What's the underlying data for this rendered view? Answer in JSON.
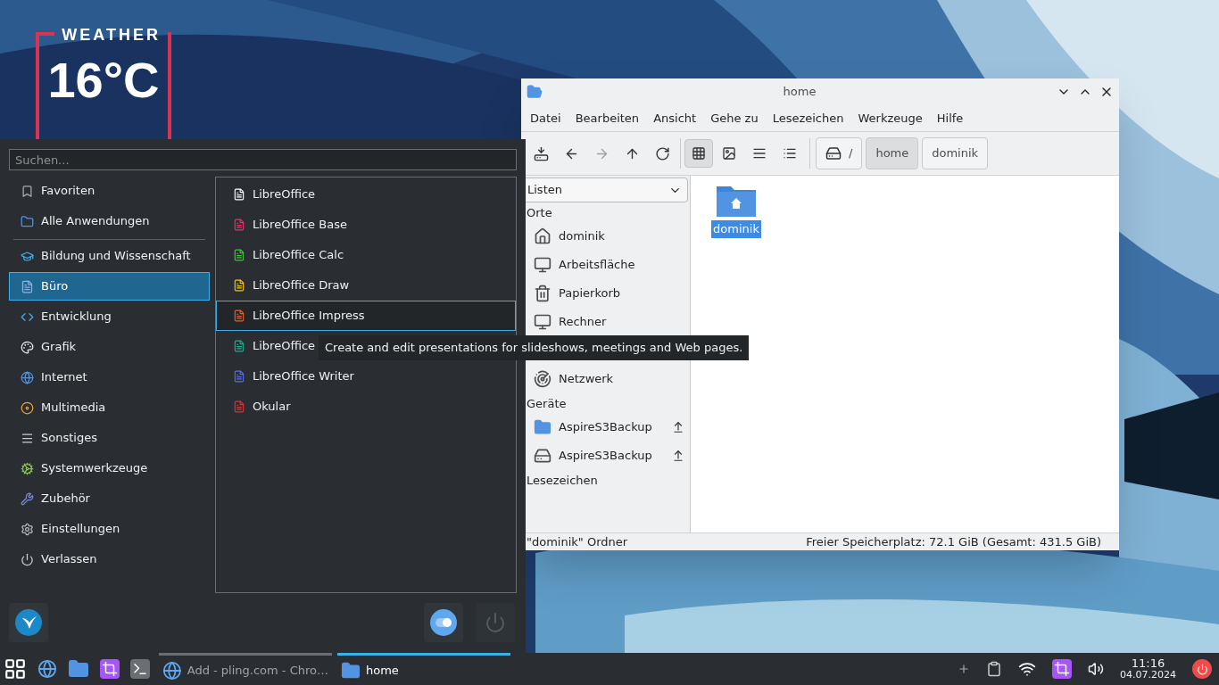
{
  "weather": {
    "title": "WEATHER",
    "temperature": "16°C"
  },
  "menu": {
    "search": {
      "placeholder": "Suchen..."
    },
    "top_items": [
      {
        "label": "Favoriten",
        "selected": false
      },
      {
        "label": "Alle Anwendungen",
        "selected": false
      }
    ],
    "categories": [
      {
        "label": "Bildung und Wissenschaft",
        "selected": false
      },
      {
        "label": "Büro",
        "selected": true
      },
      {
        "label": "Entwicklung",
        "selected": false
      },
      {
        "label": "Grafik",
        "selected": false
      },
      {
        "label": "Internet",
        "selected": false
      },
      {
        "label": "Multimedia",
        "selected": false
      },
      {
        "label": "Sonstiges",
        "selected": false
      },
      {
        "label": "Systemwerkzeuge",
        "selected": false
      },
      {
        "label": "Zubehör",
        "selected": false
      },
      {
        "label": "Einstellungen",
        "selected": false
      },
      {
        "label": "Verlassen",
        "selected": false
      }
    ],
    "apps": [
      {
        "label": "LibreOffice",
        "selected": false
      },
      {
        "label": "LibreOffice Base",
        "selected": false
      },
      {
        "label": "LibreOffice Calc",
        "selected": false
      },
      {
        "label": "LibreOffice Draw",
        "selected": false
      },
      {
        "label": "LibreOffice Impress",
        "selected": true
      },
      {
        "label": "LibreOffice",
        "selected": false
      },
      {
        "label": "LibreOffice Writer",
        "selected": false
      },
      {
        "label": "Okular",
        "selected": false
      }
    ],
    "tooltip": "Create and edit presentations for slideshows, meetings and Web pages."
  },
  "file_manager": {
    "title": "home",
    "menu": [
      "Datei",
      "Bearbeiten",
      "Ansicht",
      "Gehe zu",
      "Lesezeichen",
      "Werkzeuge",
      "Hilfe"
    ],
    "nav": [
      {
        "disabled": false
      },
      {
        "disabled": false
      },
      {
        "disabled": true
      },
      {
        "disabled": false
      },
      {
        "disabled": false
      }
    ],
    "views": [
      {
        "selected": true
      },
      {
        "selected": false
      },
      {
        "selected": false
      },
      {
        "selected": false
      }
    ],
    "breadcrumbs": [
      {
        "label": "/",
        "kind": "root",
        "selected": false
      },
      {
        "label": "home",
        "kind": "folder",
        "selected": true
      },
      {
        "label": "dominik",
        "kind": "folder",
        "selected": false
      }
    ],
    "side_mode": "Listen",
    "sections": [
      {
        "title": "Orte",
        "items": [
          {
            "kind": "item",
            "label": "dominik"
          },
          {
            "kind": "item",
            "label": "Arbeitsfläche"
          },
          {
            "kind": "item",
            "label": "Papierkorb"
          },
          {
            "kind": "item",
            "label": "Rechner"
          },
          {
            "kind": "covered"
          },
          {
            "kind": "item",
            "label": "Netzwerk"
          }
        ]
      },
      {
        "title": "Geräte",
        "items": [
          {
            "kind": "item",
            "label": "AspireS3Backup",
            "eject": true
          },
          {
            "kind": "item",
            "label": "AspireS3Backup",
            "eject": true
          }
        ]
      },
      {
        "title": "Lesezeichen"
      }
    ],
    "files": [
      {
        "label": "dominik",
        "selected": true
      }
    ],
    "status_left": "\"dominik\" Ordner",
    "status_right": "Freier Speicherplatz: 72.1 GiB (Gesamt: 431.5 GiB)"
  },
  "taskbar": {
    "tasks": [
      {
        "label": "Add - pling.com - Chro…",
        "selected": false
      },
      {
        "label": "home",
        "selected": true
      }
    ],
    "clock": {
      "time": "11:16",
      "date": "04.07.2024"
    }
  }
}
